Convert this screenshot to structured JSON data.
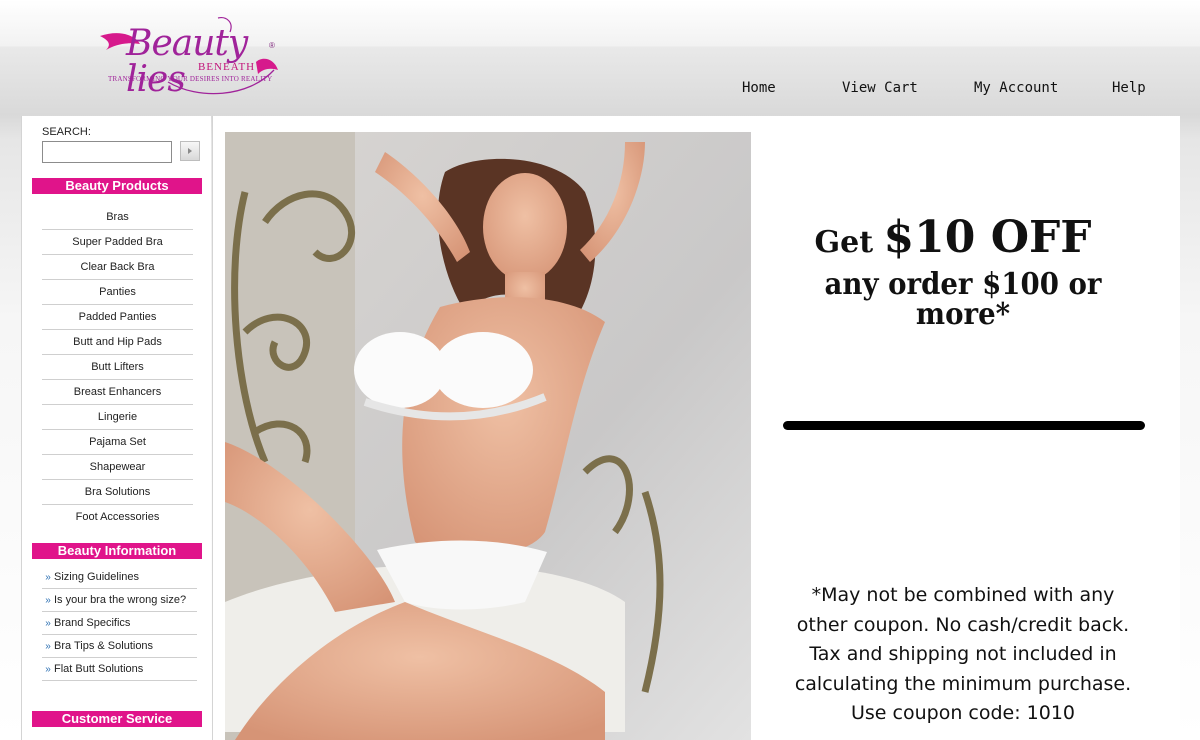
{
  "logo": {
    "script": "Beauty lies",
    "beneath": "BENEATH",
    "registered": "®",
    "tagline": "TRANSFORMING YOUR DESIRES INTO REALITY",
    "brand_color": "#a0239a",
    "accent_color": "#e0148a"
  },
  "nav": [
    {
      "label": "Home"
    },
    {
      "label": "View Cart"
    },
    {
      "label": "My Account"
    },
    {
      "label": "Help"
    }
  ],
  "search": {
    "label": "SEARCH:",
    "value": "",
    "button_icon": "play-arrow-icon"
  },
  "sidebar": {
    "beauty_products": {
      "title": "Beauty Products",
      "items": [
        "Bras",
        "Super Padded Bra",
        "Clear Back Bra",
        "Panties",
        "Padded Panties",
        "Butt and Hip Pads",
        "Butt Lifters",
        "Breast Enhancers",
        "Lingerie",
        "Pajama Set",
        "Shapewear",
        "Bra Solutions",
        "Foot Accessories"
      ]
    },
    "beauty_information": {
      "title": "Beauty Information",
      "bullet_icon": "double-chevron-right-icon",
      "items": [
        "Sizing Guidelines",
        "Is your bra the wrong size?",
        "Brand Specifics",
        "Bra Tips & Solutions",
        "Flat Butt Solutions"
      ]
    },
    "customer_service": {
      "title": "Customer Service"
    }
  },
  "promo": {
    "get": "Get",
    "amount": "$10 OFF",
    "line2": "any order $100 or more*",
    "fine_print": [
      "*May not be combined with any",
      "other coupon. No cash/credit back.",
      "Tax and shipping not included in",
      "calculating the minimum purchase.",
      "Use coupon code: 1010"
    ],
    "hero_image": "model-in-white-lingerie-photo"
  }
}
